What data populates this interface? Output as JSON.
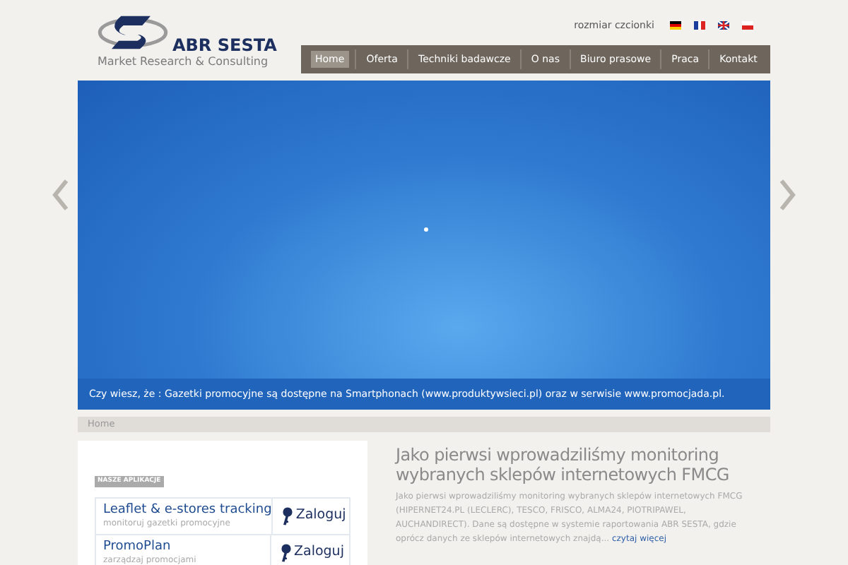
{
  "header": {
    "brand": "ABR SESTA",
    "tagline": "Market Research & Consulting",
    "font_size_label": "rozmiar czcionki"
  },
  "nav": [
    {
      "label": "Home",
      "selected": true
    },
    {
      "label": "Oferta",
      "selected": false
    },
    {
      "label": "Techniki badawcze",
      "selected": false
    },
    {
      "label": "O nas",
      "selected": false
    },
    {
      "label": "Biuro prasowe",
      "selected": false
    },
    {
      "label": "Praca",
      "selected": false
    },
    {
      "label": "Kontakt",
      "selected": false
    }
  ],
  "slider": {
    "caption": "Czy wiesz, że  : Gazetki promocyjne są dostępne na Smartphonach (www.produktywsieci.pl) oraz w serwisie www.promocjada.pl."
  },
  "breadcrumb": "Home",
  "apps": {
    "heading": "NASZE APLIKACJE",
    "items": [
      {
        "title": "Leaflet & e-stores tracking",
        "subtitle": "monitoruj gazetki promocyjne",
        "action": "Zaloguj"
      },
      {
        "title": "PromoPlan",
        "subtitle": "zarządzaj promocjami",
        "action": "Zaloguj"
      }
    ]
  },
  "news": {
    "title": "Jako pierwsi wprowadziliśmy monitoring wybranych sklepów internetowych FMCG",
    "body": "Jako pierwsi wprowadziliśmy monitoring wybranych sklepów internetowych FMCG (HIPERNET24.PL (LECLERC), TESCO, FRISCO, ALMA24, PIOTRIPAWEL, AUCHANDIRECT). Dane są dostępne w systemie raportowania ABR SESTA, gdzie oprócz danych ze sklepów internetowych znajdą...",
    "more": "czytaj więcej"
  }
}
